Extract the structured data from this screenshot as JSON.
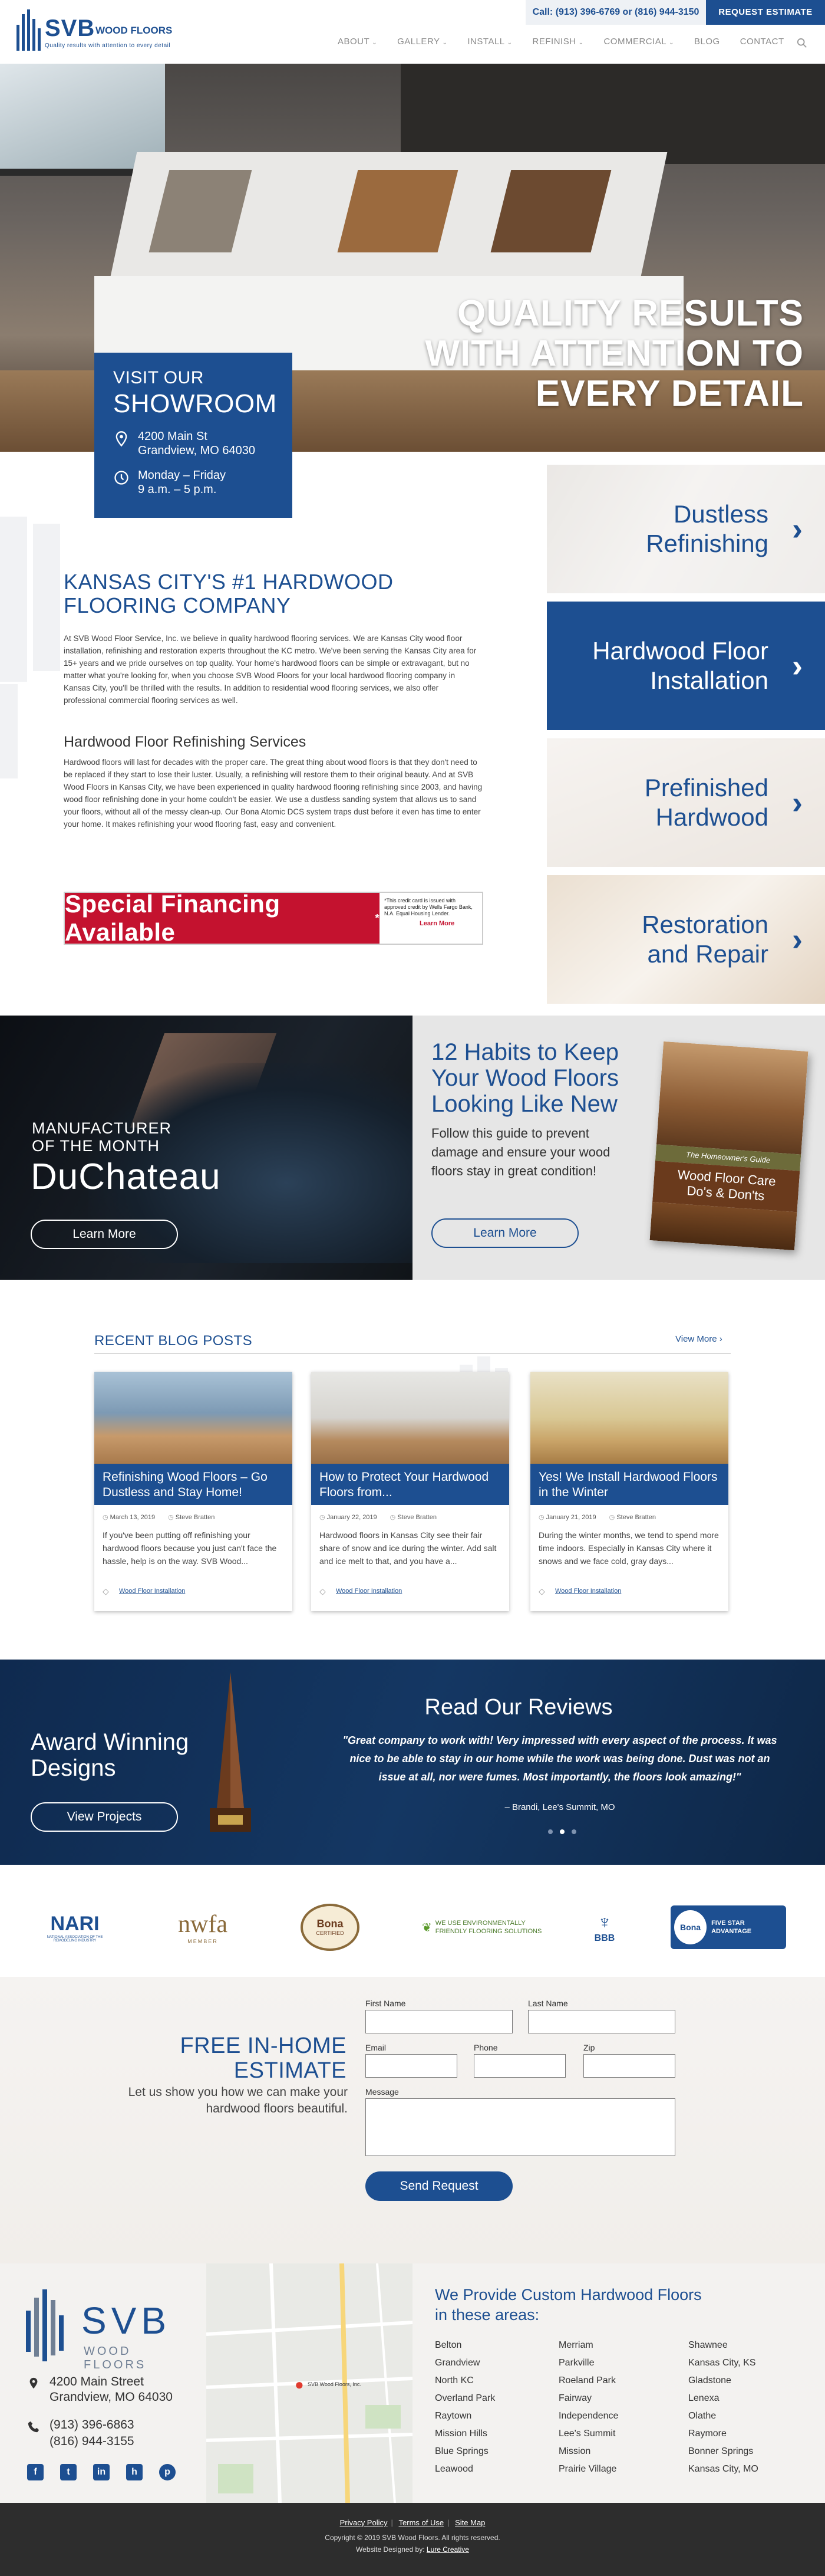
{
  "header": {
    "logo_text": "SVB",
    "logo_sub": "WOOD FLOORS",
    "logo_tag": "Quality results with attention to every detail",
    "phone_bar": "Call: (913) 396-6769 or (816) 944-3150",
    "request_btn": "REQUEST ESTIMATE",
    "nav": [
      {
        "label": "ABOUT",
        "dropdown": true
      },
      {
        "label": "GALLERY",
        "dropdown": true
      },
      {
        "label": "INSTALL",
        "dropdown": true
      },
      {
        "label": "REFINISH",
        "dropdown": true
      },
      {
        "label": "COMMERCIAL",
        "dropdown": true
      },
      {
        "label": "BLOG",
        "dropdown": false
      },
      {
        "label": "CONTACT",
        "dropdown": false
      }
    ],
    "search_icon": "search-icon"
  },
  "hero": {
    "headline_1": "QUALITY RESULTS",
    "headline_2": "WITH ATTENTION TO",
    "headline_3": "EVERY DETAIL"
  },
  "showroom": {
    "line1": "VISIT OUR",
    "line2": "SHOWROOM",
    "address_1": "4200 Main St",
    "address_2": "Grandview, MO 64030",
    "hours_1": "Monday – Friday",
    "hours_2": "9 a.m. – 5 p.m."
  },
  "intro": {
    "heading_1": "KANSAS CITY'S #1 HARDWOOD",
    "heading_2": "FLOORING COMPANY",
    "paragraph": "At SVB Wood Floor Service, Inc. we believe in quality hardwood flooring services. We are Kansas City wood floor installation, refinishing and restoration experts throughout the KC metro. We've been serving the Kansas City area for 15+ years and we pride ourselves on top quality. Your home's hardwood floors can be simple or extravagant, but no matter what you're looking for, when you choose SVB Wood Floors for your local hardwood flooring company in Kansas City, you'll be thrilled with the results. In addition to residential wood flooring services, we also offer professional commercial flooring services as well.",
    "refin_heading": "Hardwood Floor Refinishing Services",
    "refin_paragraph": "Hardwood floors will last for decades with the proper care. The great thing about wood floors is that they don't need to be replaced if they start to lose their luster. Usually, a refinishing will restore them to their original beauty. And at SVB Wood Floors in Kansas City, we have been experienced in quality hardwood flooring refinishing since 2003, and having wood floor refinishing done in your home couldn't be easier. We use a dustless sanding system that allows us to sand your floors, without all of the messy clean-up. Our Bona Atomic DCS system traps dust before it even has time to enter your home. It makes refinishing your wood flooring fast, easy and convenient."
  },
  "financing": {
    "headline": "Special Financing Available",
    "fine_print": "*This credit card is issued with approved credit by Wells Fargo Bank, N.A. Equal Housing Lender.",
    "link": "Learn More"
  },
  "tiles": [
    {
      "label_1": "Dustless",
      "label_2": "Refinishing",
      "style": "light"
    },
    {
      "label_1": "Hardwood Floor",
      "label_2": "Installation",
      "style": "dark"
    },
    {
      "label_1": "Prefinished",
      "label_2": "Hardwood",
      "style": "light"
    },
    {
      "label_1": "Restoration",
      "label_2": "and Repair",
      "style": "light"
    }
  ],
  "duchateau": {
    "line_1": "MANUFACTURER",
    "line_2": "OF THE MONTH",
    "brand": "DuChateau",
    "button": "Learn More"
  },
  "guide": {
    "heading": "12 Habits to Keep Your Wood Floors Looking Like New",
    "paragraph": "Follow this guide to prevent damage and ensure your wood floors stay in great condition!",
    "button": "Learn More",
    "book_sub": "The Homeowner's Guide",
    "book_title_1": "Wood Floor Care",
    "book_title_2": "Do's & Don'ts"
  },
  "blog": {
    "heading": "RECENT BLOG POSTS",
    "view_more": "View More ›",
    "posts": [
      {
        "title": "Refinishing Wood Floors – Go Dustless and Stay Home!",
        "date": "March 13, 2019",
        "author": "Steve Bratten",
        "excerpt": "If you've been putting off refinishing your hardwood floors because you just can't face the hassle, help is on the way. SVB Wood...",
        "category": "Wood Floor Installation"
      },
      {
        "title": "How to Protect Your Hardwood Floors from...",
        "date": "January 22, 2019",
        "author": "Steve Bratten",
        "excerpt": "Hardwood floors in Kansas City see their fair share of snow and ice during the winter. Add salt and ice melt to that, and you have a...",
        "category": "Wood Floor Installation"
      },
      {
        "title": "Yes! We Install Hardwood Floors in the Winter",
        "date": "January 21, 2019",
        "author": "Steve Bratten",
        "excerpt": "During the winter months, we tend to spend more time indoors. Especially in Kansas City where it snows and we face cold, gray days...",
        "category": "Wood Floor Installation"
      }
    ]
  },
  "award": {
    "heading_1": "Award Winning",
    "heading_2": "Designs",
    "button": "View Projects"
  },
  "reviews": {
    "heading": "Read Our Reviews",
    "quote": "\"Great company to work with! Very impressed with every aspect of the process. It was nice to be able to stay in our home while the work was being done. Dust was not an issue at all, nor were fumes. Most importantly, the floors look amazing!\"",
    "author": "– Brandi, Lee's Summit, MO"
  },
  "brands": [
    {
      "name": "NARI",
      "sub": "NATIONAL ASSOCIATION OF THE REMODELING INDUSTRY"
    },
    {
      "name": "nwfa",
      "sub": "MEMBER"
    },
    {
      "name": "Bona",
      "sub": "CERTIFIED"
    },
    {
      "name": "WE USE ENVIRONMENTALLY FRIENDLY FLOORING SOLUTIONS",
      "sub": ""
    },
    {
      "name": "BBB",
      "sub": ""
    },
    {
      "name": "FIVE STAR ADVANTAGE",
      "sub": "Bona"
    }
  ],
  "estimate": {
    "heading_1": "FREE IN-HOME",
    "heading_2": "ESTIMATE",
    "paragraph": "Let us show you how we can make your hardwood floors beautiful.",
    "labels": {
      "first": "First Name",
      "last": "Last Name",
      "email": "Email",
      "phone": "Phone",
      "zip": "Zip",
      "message": "Message"
    },
    "button": "Send Request"
  },
  "footer": {
    "logo_text": "SVB",
    "logo_sub": "WOOD FLOORS",
    "address_1": "4200 Main Street",
    "address_2": "Grandview, MO 64030",
    "phone_1": "(913) 396-6863",
    "phone_2": "(816) 944-3155",
    "areas_heading_1": "We Provide Custom Hardwood Floors",
    "areas_heading_2": "in these areas:",
    "areas_col1": [
      "Belton",
      "Grandview",
      "North KC",
      "Overland Park",
      "Raytown",
      "Mission Hills",
      "Blue Springs",
      "Leawood"
    ],
    "areas_col2": [
      "Merriam",
      "Parkville",
      "Roeland Park",
      "Fairway",
      "Independence",
      "Lee's Summit",
      "Mission",
      "Prairie Village"
    ],
    "areas_col3": [
      "Shawnee",
      "Kansas City, KS",
      "Gladstone",
      "Lenexa",
      "Olathe",
      "Raymore",
      "Bonner Springs",
      "Kansas City, MO"
    ],
    "map_label": "SVB Wood Floors, Inc."
  },
  "bottom": {
    "privacy": "Privacy Policy",
    "terms": "Terms of Use",
    "sitemap": "Site Map",
    "copyright": "Copyright © 2019 SVB Wood Floors. All rights reserved.",
    "designed_prefix": "Website Designed by: ",
    "designer": "Lure Creative"
  },
  "colors": {
    "brand_blue": "#1d4f91",
    "financing_red": "#c4122f",
    "dark_navy": "#0f2a4f"
  }
}
